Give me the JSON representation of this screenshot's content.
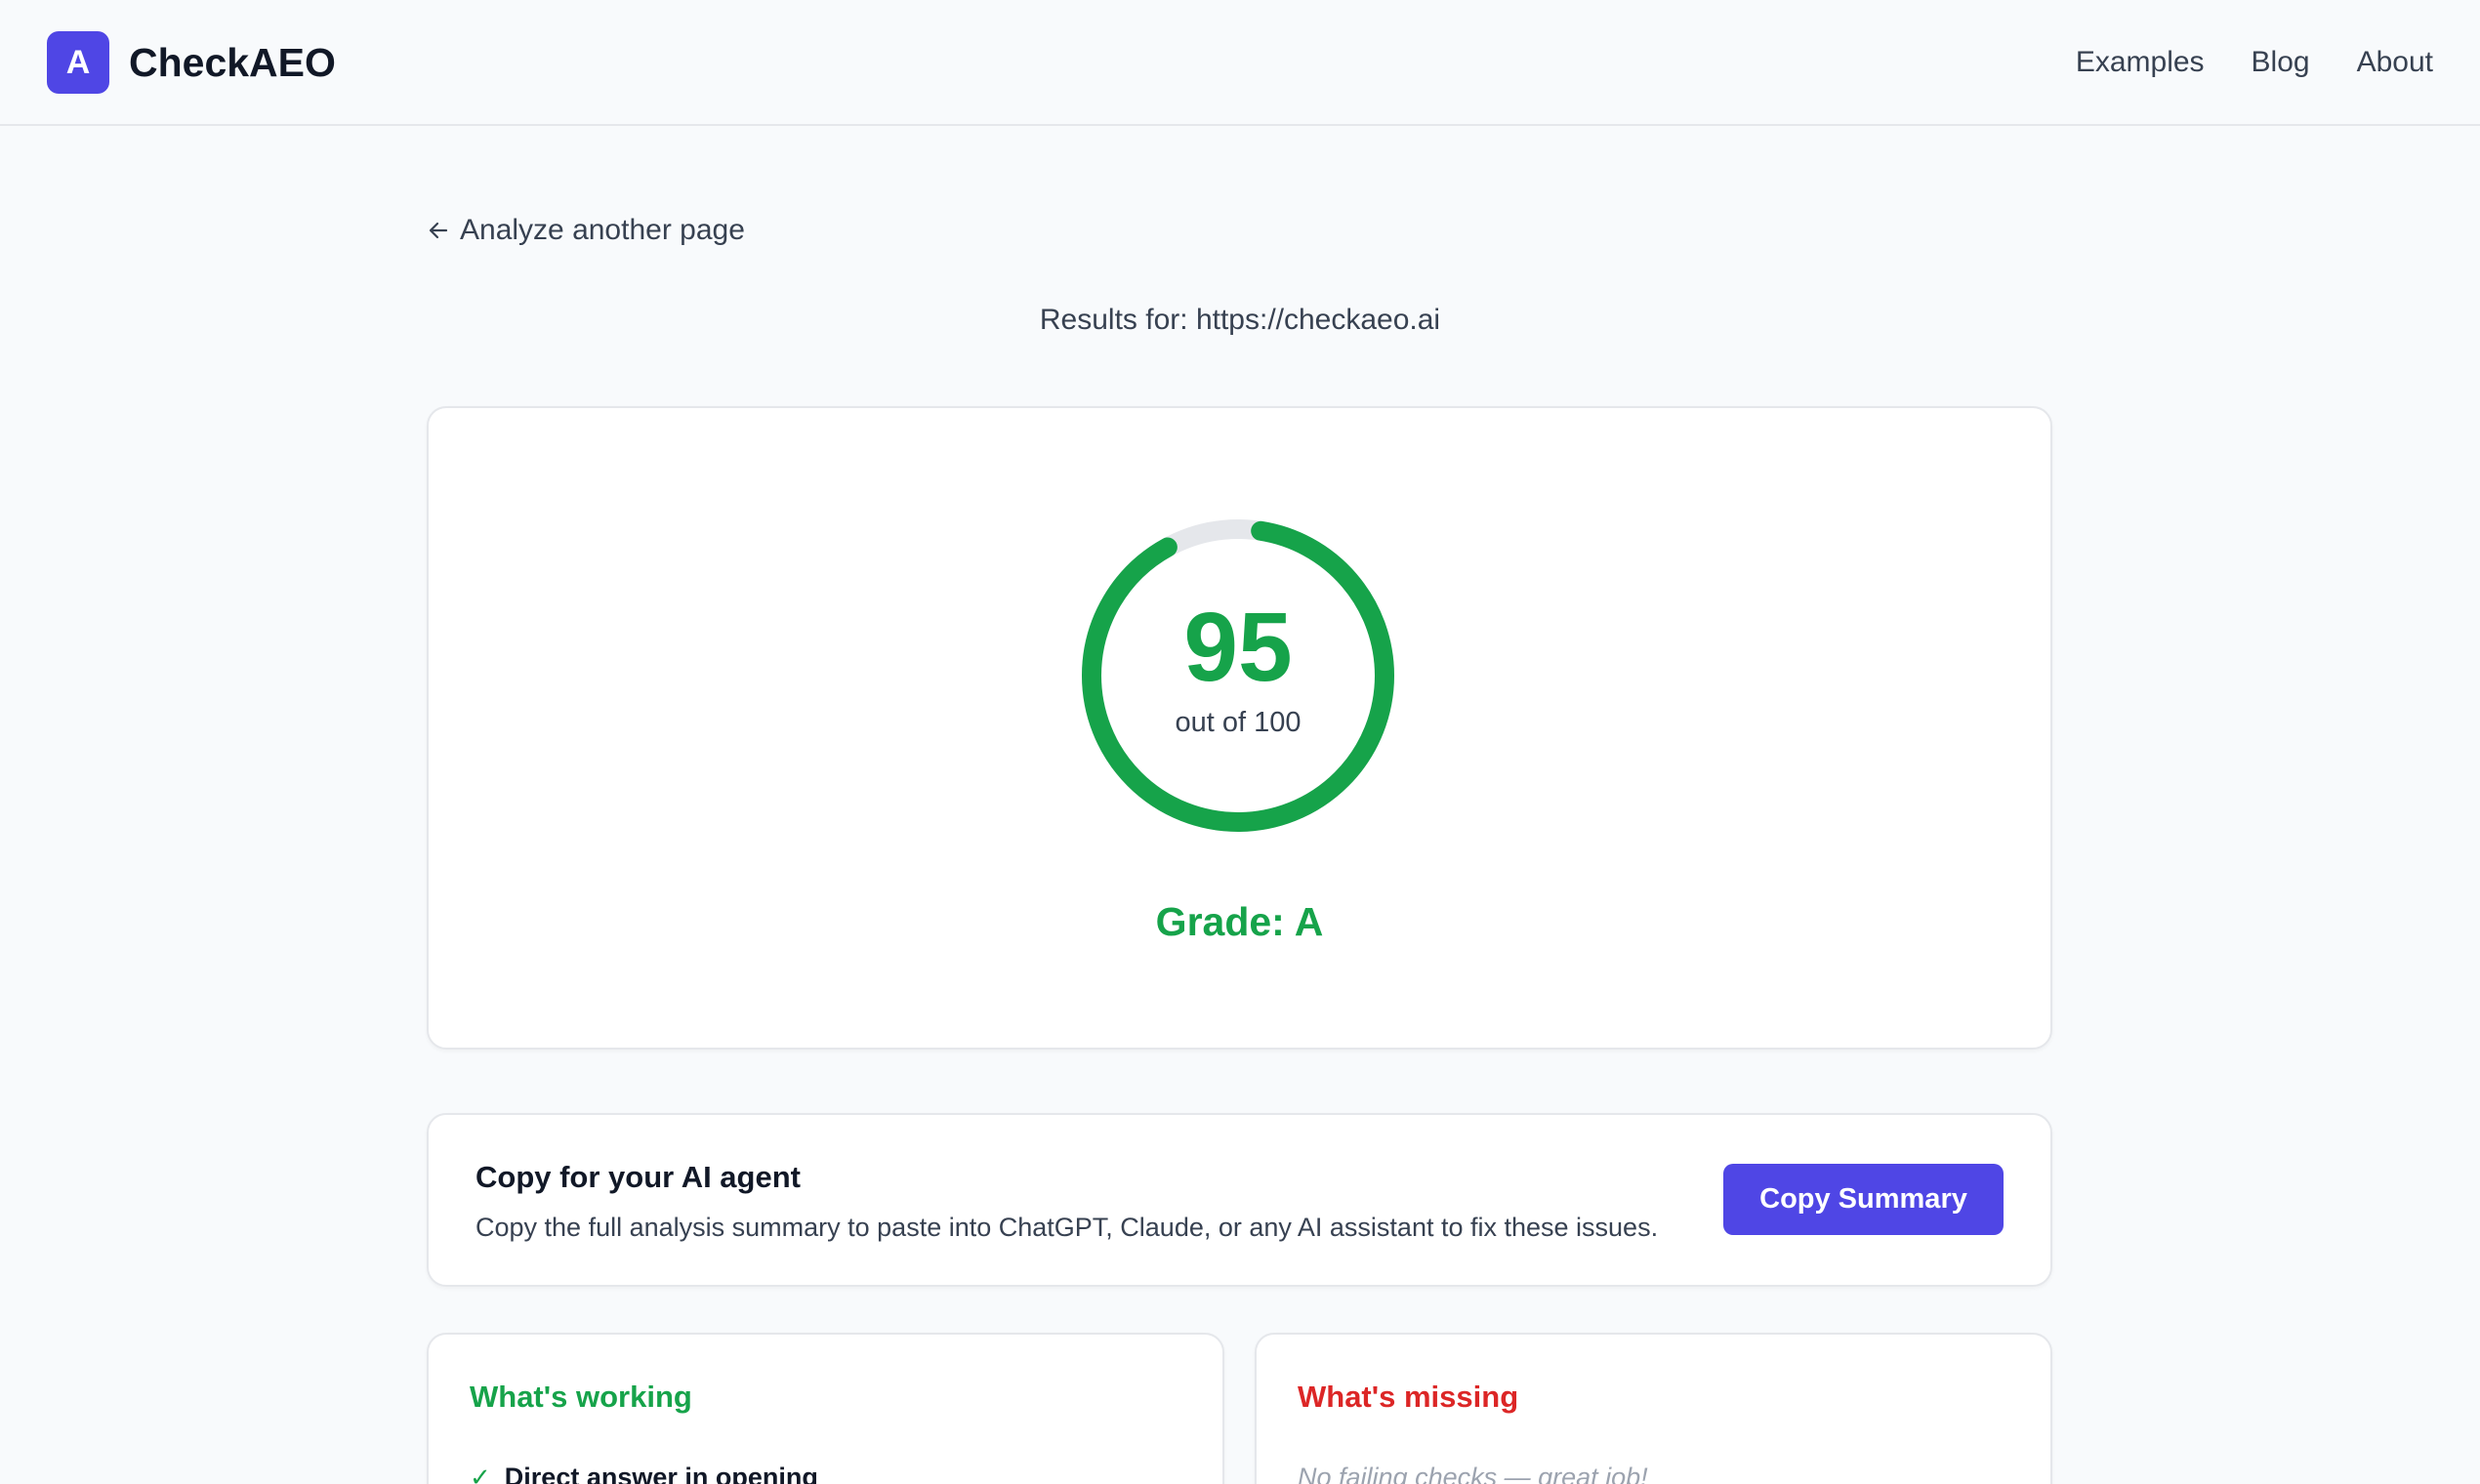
{
  "header": {
    "logo_letter": "A",
    "brand": "CheckAEO",
    "nav": [
      {
        "label": "Examples"
      },
      {
        "label": "Blog"
      },
      {
        "label": "About"
      }
    ]
  },
  "back_link": "Analyze another page",
  "results_for": "Results for: https://checkaeo.ai",
  "score": {
    "value": "95",
    "max_label": "out of 100",
    "fraction": 0.95,
    "grade": "Grade: A",
    "color": "#16a34a",
    "track_color": "#e5e7eb"
  },
  "copy_card": {
    "title": "Copy for your AI agent",
    "description": "Copy the full analysis summary to paste into ChatGPT, Claude, or any AI assistant to fix these issues.",
    "button": "Copy Summary",
    "accent": "#4f46e5"
  },
  "working": {
    "title": "What's working",
    "items": [
      {
        "icon": "check-icon",
        "label": "Direct answer in opening"
      }
    ]
  },
  "missing": {
    "title": "What's missing",
    "empty": "No failing checks — great job!"
  }
}
